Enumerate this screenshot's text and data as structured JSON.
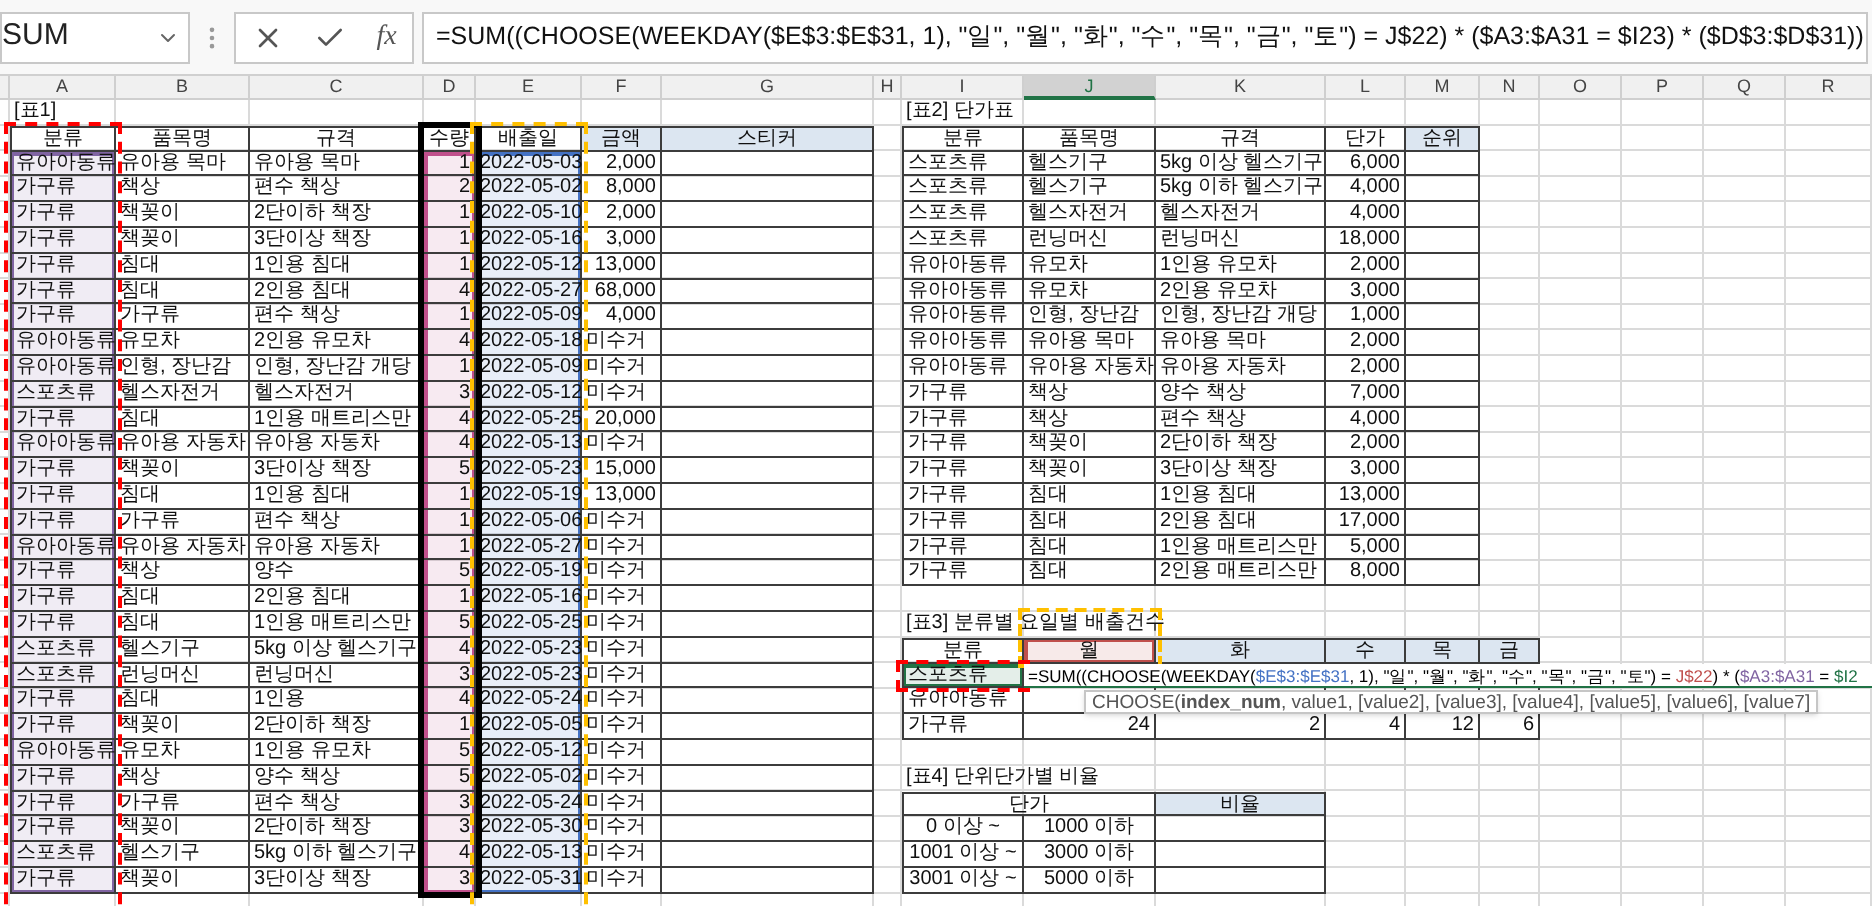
{
  "formula_bar": {
    "name_box": "SUM",
    "function_label": "fx",
    "formula": "=SUM((CHOOSE(WEEKDAY($E$3:$E$31, 1), \"일\", \"월\", \"화\", \"수\", \"목\", \"금\", \"토\") = J$22) * ($A3:$A31 = $I23) * ($D$3:$D$31))"
  },
  "columns": [
    {
      "label": "A",
      "selected": false
    },
    {
      "label": "B",
      "selected": false
    },
    {
      "label": "C",
      "selected": false
    },
    {
      "label": "D",
      "selected": false
    },
    {
      "label": "E",
      "selected": false
    },
    {
      "label": "F",
      "selected": false
    },
    {
      "label": "G",
      "selected": false
    },
    {
      "label": "H",
      "selected": false
    },
    {
      "label": "I",
      "selected": false
    },
    {
      "label": "J",
      "selected": true
    },
    {
      "label": "K",
      "selected": false
    },
    {
      "label": "L",
      "selected": false
    },
    {
      "label": "M",
      "selected": false
    },
    {
      "label": "N",
      "selected": false
    },
    {
      "label": "O",
      "selected": false
    },
    {
      "label": "P",
      "selected": false
    },
    {
      "label": "Q",
      "selected": false
    },
    {
      "label": "R",
      "selected": false
    }
  ],
  "table1": {
    "title": "[표1]",
    "headers": [
      {
        "text": "분류",
        "shaded": false
      },
      {
        "text": "품목명",
        "shaded": false
      },
      {
        "text": "규격",
        "shaded": false
      },
      {
        "text": "수량",
        "shaded": false
      },
      {
        "text": "배출일",
        "shaded": false
      },
      {
        "text": "금액",
        "shaded": true
      },
      {
        "text": "스티커",
        "shaded": true
      }
    ],
    "rows": [
      [
        "유아아동류",
        "유아용 목마",
        "유아용 목마",
        "1",
        "2022-05-03",
        "2,000"
      ],
      [
        "가구류",
        "책상",
        "편수 책상",
        "2",
        "2022-05-02",
        "8,000"
      ],
      [
        "가구류",
        "책꽂이",
        "2단이하 책장",
        "1",
        "2022-05-10",
        "2,000"
      ],
      [
        "가구류",
        "책꽂이",
        "3단이상 책장",
        "1",
        "2022-05-16",
        "3,000"
      ],
      [
        "가구류",
        "침대",
        "1인용 침대",
        "1",
        "2022-05-12",
        "13,000"
      ],
      [
        "가구류",
        "침대",
        "2인용 침대",
        "4",
        "2022-05-27",
        "68,000"
      ],
      [
        "가구류",
        "가구류",
        "편수 책상",
        "1",
        "2022-05-09",
        "4,000"
      ],
      [
        "유아아동류",
        "유모차",
        "2인용 유모차",
        "4",
        "2022-05-18",
        "미수거"
      ],
      [
        "유아아동류",
        "인형, 장난감",
        "인형, 장난감 개당",
        "1",
        "2022-05-09",
        "미수거"
      ],
      [
        "스포츠류",
        "헬스자전거",
        "헬스자전거",
        "3",
        "2022-05-12",
        "미수거"
      ],
      [
        "가구류",
        "침대",
        "1인용 매트리스만",
        "4",
        "2022-05-25",
        "20,000"
      ],
      [
        "유아아동류",
        "유아용 자동차",
        "유아용 자동차",
        "4",
        "2022-05-13",
        "미수거"
      ],
      [
        "가구류",
        "책꽂이",
        "3단이상 책장",
        "5",
        "2022-05-23",
        "15,000"
      ],
      [
        "가구류",
        "침대",
        "1인용 침대",
        "1",
        "2022-05-19",
        "13,000"
      ],
      [
        "가구류",
        "가구류",
        "편수 책상",
        "1",
        "2022-05-06",
        "미수거"
      ],
      [
        "유아아동류",
        "유아용 자동차",
        "유아용 자동차",
        "1",
        "2022-05-27",
        "미수거"
      ],
      [
        "가구류",
        "책상",
        "양수",
        "5",
        "2022-05-19",
        "미수거"
      ],
      [
        "가구류",
        "침대",
        "2인용 침대",
        "1",
        "2022-05-16",
        "미수거"
      ],
      [
        "가구류",
        "침대",
        "1인용 매트리스만",
        "5",
        "2022-05-25",
        "미수거"
      ],
      [
        "스포츠류",
        "헬스기구",
        "5kg 이상 헬스기구",
        "4",
        "2022-05-23",
        "미수거"
      ],
      [
        "스포츠류",
        "런닝머신",
        "런닝머신",
        "3",
        "2022-05-23",
        "미수거"
      ],
      [
        "가구류",
        "침대",
        "1인용",
        "4",
        "2022-05-24",
        "미수거"
      ],
      [
        "가구류",
        "책꽂이",
        "2단이하 책장",
        "1",
        "2022-05-05",
        "미수거"
      ],
      [
        "유아아동류",
        "유모차",
        "1인용 유모차",
        "5",
        "2022-05-12",
        "미수거"
      ],
      [
        "가구류",
        "책상",
        "양수 책상",
        "5",
        "2022-05-02",
        "미수거"
      ],
      [
        "가구류",
        "가구류",
        "편수 책상",
        "3",
        "2022-05-24",
        "미수거"
      ],
      [
        "가구류",
        "책꽂이",
        "2단이하 책장",
        "3",
        "2022-05-30",
        "미수거"
      ],
      [
        "스포츠류",
        "헬스기구",
        "5kg 이하 헬스기구",
        "4",
        "2022-05-13",
        "미수거"
      ],
      [
        "가구류",
        "책꽂이",
        "3단이상 책장",
        "3",
        "2022-05-31",
        "미수거"
      ]
    ]
  },
  "table2": {
    "title": "[표2] 단가표",
    "headers": [
      {
        "text": "분류",
        "shaded": false
      },
      {
        "text": "품목명",
        "shaded": false
      },
      {
        "text": "규격",
        "shaded": false
      },
      {
        "text": "단가",
        "shaded": false
      },
      {
        "text": "순위",
        "shaded": true
      }
    ],
    "rows": [
      [
        "스포츠류",
        "헬스기구",
        "5kg 이상 헬스기구",
        "6,000"
      ],
      [
        "스포츠류",
        "헬스기구",
        "5kg 이하 헬스기구",
        "4,000"
      ],
      [
        "스포츠류",
        "헬스자전거",
        "헬스자전거",
        "4,000"
      ],
      [
        "스포츠류",
        "런닝머신",
        "런닝머신",
        "18,000"
      ],
      [
        "유아아동류",
        "유모차",
        "1인용 유모차",
        "2,000"
      ],
      [
        "유아아동류",
        "유모차",
        "2인용 유모차",
        "3,000"
      ],
      [
        "유아아동류",
        "인형, 장난감",
        "인형, 장난감 개당",
        "1,000"
      ],
      [
        "유아아동류",
        "유아용 목마",
        "유아용 목마",
        "2,000"
      ],
      [
        "유아아동류",
        "유아용 자동차",
        "유아용 자동차",
        "2,000"
      ],
      [
        "가구류",
        "책상",
        "양수 책상",
        "7,000"
      ],
      [
        "가구류",
        "책상",
        "편수 책상",
        "4,000"
      ],
      [
        "가구류",
        "책꽂이",
        "2단이하 책장",
        "2,000"
      ],
      [
        "가구류",
        "책꽂이",
        "3단이상 책장",
        "3,000"
      ],
      [
        "가구류",
        "침대",
        "1인용 침대",
        "13,000"
      ],
      [
        "가구류",
        "침대",
        "2인용 침대",
        "17,000"
      ],
      [
        "가구류",
        "침대",
        "1인용 매트리스만",
        "5,000"
      ],
      [
        "가구류",
        "침대",
        "2인용 매트리스만",
        "8,000"
      ]
    ]
  },
  "table3": {
    "title": "[표3] 분류별 요일별 배출건수",
    "headers": [
      {
        "text": "분류",
        "shaded": false
      },
      {
        "text": "월",
        "shaded": false
      },
      {
        "text": "화",
        "shaded": true
      },
      {
        "text": "수",
        "shaded": true
      },
      {
        "text": "목",
        "shaded": true
      },
      {
        "text": "금",
        "shaded": true
      }
    ],
    "rows": [
      [
        "스포츠류"
      ],
      [
        "유아아동류"
      ],
      [
        "가구류",
        "24",
        "2",
        "4",
        "12",
        "6"
      ]
    ]
  },
  "table4": {
    "title": "[표4] 단위단가별 비율",
    "headers": [
      {
        "text": "단가",
        "shaded": false
      },
      {
        "text": "비율",
        "shaded": true
      }
    ],
    "rows": [
      [
        "0 이상 ~",
        "1000 이하"
      ],
      [
        "1001 이상 ~",
        "3000 이하"
      ],
      [
        "3001 이상 ~",
        "5000 이하"
      ]
    ]
  },
  "reference_highlights": [
    {
      "color": "#8064a2"
    },
    {
      "color": "#c0508c"
    },
    {
      "color": "#4472c4"
    },
    {
      "color": "#c0504d"
    },
    {
      "color": "#217346"
    }
  ],
  "annotations": [
    {
      "kind": "dashed",
      "color": "#ff0000"
    },
    {
      "kind": "solid",
      "color": "#000000"
    },
    {
      "kind": "dashed",
      "color": "#ffc000"
    },
    {
      "kind": "dashed",
      "color": "#ffc000"
    },
    {
      "kind": "dashed",
      "color": "#ff0000"
    }
  ],
  "cell_edit": {
    "segments": [
      {
        "text": "=SUM((CHOOSE(WEEKDAY(",
        "color": "#000000"
      },
      {
        "text": "$E$3:$E$31",
        "color": "#4472c4"
      },
      {
        "text": ", 1), \"일\", \"월\", \"화\", \"수\", \"목\", \"금\", \"토\") = ",
        "color": "#000000"
      },
      {
        "text": "J$22",
        "color": "#c0504d"
      },
      {
        "text": ") * (",
        "color": "#000000"
      },
      {
        "text": "$A3:$A31",
        "color": "#8064a2"
      },
      {
        "text": " = ",
        "color": "#000000"
      },
      {
        "text": "$I2",
        "color": "#217346"
      }
    ]
  },
  "tooltip": "CHOOSE(**index_num**, value1, [value2], [value3], [value4], [value5], [value6], [value7]"
}
